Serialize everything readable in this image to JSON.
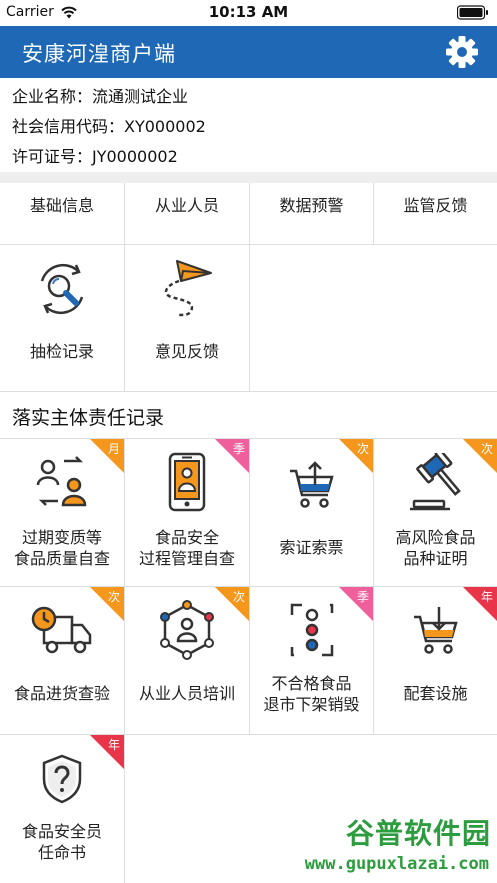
{
  "status_bar": {
    "carrier": "Carrier",
    "time": "10:13 AM"
  },
  "header": {
    "title": "安康河湟商户端"
  },
  "company": {
    "name": "企业名称：流通测试企业",
    "credit_code": "社会信用代码：XY000002",
    "license": "许可证号：JY0000002"
  },
  "tabs": [
    {
      "label": "基础信息"
    },
    {
      "label": "从业人员"
    },
    {
      "label": "数据预警"
    },
    {
      "label": "监管反馈"
    }
  ],
  "quick_actions": [
    {
      "label": "抽检记录",
      "icon": "inspection-search-icon"
    },
    {
      "label": "意见反馈",
      "icon": "paper-plane-icon"
    }
  ],
  "section": {
    "title": "落实主体责任记录"
  },
  "records": [
    {
      "line1": "过期变质等",
      "line2": "食品质量自查",
      "badge": "月",
      "badge_color": "#f5961d",
      "icon": "person-exchange-icon"
    },
    {
      "line1": "食品安全",
      "line2": "过程管理自查",
      "badge": "季",
      "badge_color": "#ef5f9c",
      "icon": "phone-person-icon"
    },
    {
      "line1": "索证索票",
      "line2": "",
      "badge": "次",
      "badge_color": "#f5961d",
      "icon": "cart-upload-icon"
    },
    {
      "line1": "高风险食品",
      "line2": "品种证明",
      "badge": "次",
      "badge_color": "#f5961d",
      "icon": "gavel-icon"
    },
    {
      "line1": "食品进货查验",
      "line2": "",
      "badge": "次",
      "badge_color": "#f5961d",
      "icon": "delivery-truck-icon"
    },
    {
      "line1": "从业人员培训",
      "line2": "",
      "badge": "次",
      "badge_color": "#f5961d",
      "icon": "people-network-icon"
    },
    {
      "line1": "不合格食品",
      "line2": "退市下架销毁",
      "badge": "季",
      "badge_color": "#ef5f9c",
      "icon": "traffic-light-icon"
    },
    {
      "line1": "配套设施",
      "line2": "",
      "badge": "年",
      "badge_color": "#e8354a",
      "icon": "cart-download-icon"
    },
    {
      "line1": "食品安全员",
      "line2": "任命书",
      "badge": "年",
      "badge_color": "#e8354a",
      "icon": "shield-question-icon"
    }
  ],
  "watermark": {
    "brand": "谷普软件园",
    "url": "www.gupuxlazai.com"
  },
  "colors": {
    "primary": "#1f68b5",
    "accent_orange": "#f5961d",
    "badge_pink": "#ef5f9c",
    "badge_red": "#e8354a"
  }
}
